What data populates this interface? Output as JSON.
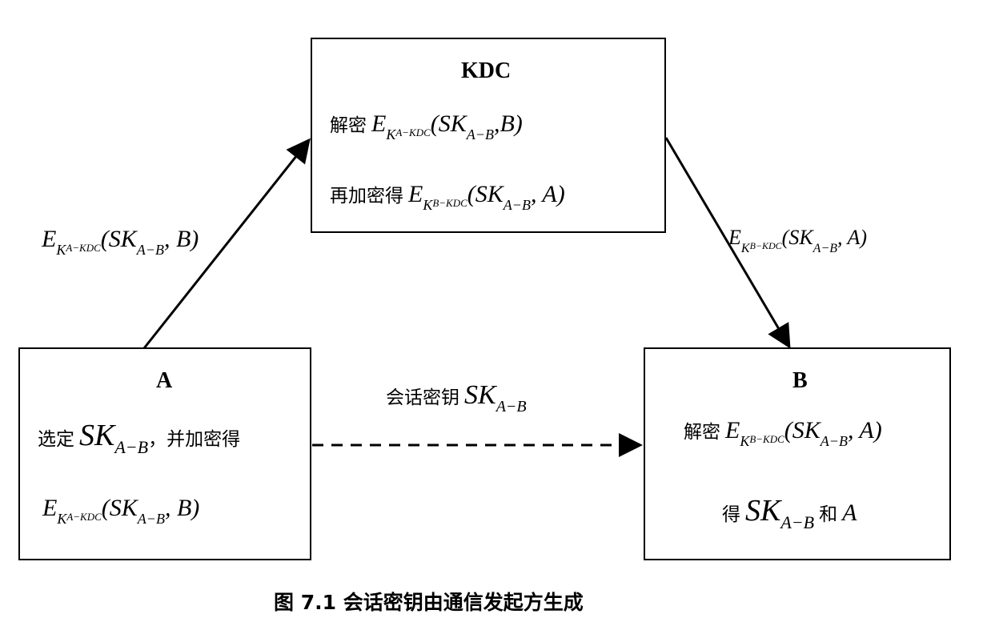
{
  "kdc": {
    "title": "KDC",
    "line1_cn": "解密",
    "line2_cn": "再加密得",
    "msg_in": {
      "E": "E",
      "K": "K",
      "k_sub": "A−KDC",
      "open": "(SK",
      "sk_sub": "A−B",
      "rest": ",B)"
    },
    "msg_out": {
      "E": "E",
      "K": "K",
      "k_sub": "B−KDC",
      "open": "(SK",
      "sk_sub": "A−B",
      "rest": ", A)"
    }
  },
  "node_a": {
    "title": "A",
    "line1_cn": "选定",
    "sk": "SK",
    "sk_sub": "A−B",
    "line1_tail": "，并加密得",
    "msg": {
      "E": "E",
      "K": "K",
      "k_sub": "A−KDC",
      "open": "(SK",
      "sk_sub": "A−B",
      "rest": ", B)"
    }
  },
  "node_b": {
    "title": "B",
    "line1_cn": "解密",
    "msg": {
      "E": "E",
      "K": "K",
      "k_sub": "B−KDC",
      "open": "(SK",
      "sk_sub": "A−B",
      "rest": ", A)"
    },
    "line2_cn": "得",
    "sk": "SK",
    "sk_sub": "A−B",
    "line2_tail_cn": "和",
    "line2_tail_var": "A"
  },
  "edge_a_kdc": {
    "E": "E",
    "K": "K",
    "k_sub": "A−KDC",
    "open": "(SK",
    "sk_sub": "A−B",
    "rest": ", B)"
  },
  "edge_kdc_b": {
    "E": "E",
    "K": "K",
    "k_sub": "B−KDC",
    "open": "(SK",
    "sk_sub": "A−B",
    "rest": ", A)"
  },
  "edge_a_b": {
    "label_cn": "会话密钥",
    "sk": "SK",
    "sk_sub": "A−B"
  },
  "caption": "图 7.1 会话密钥由通信发起方生成"
}
